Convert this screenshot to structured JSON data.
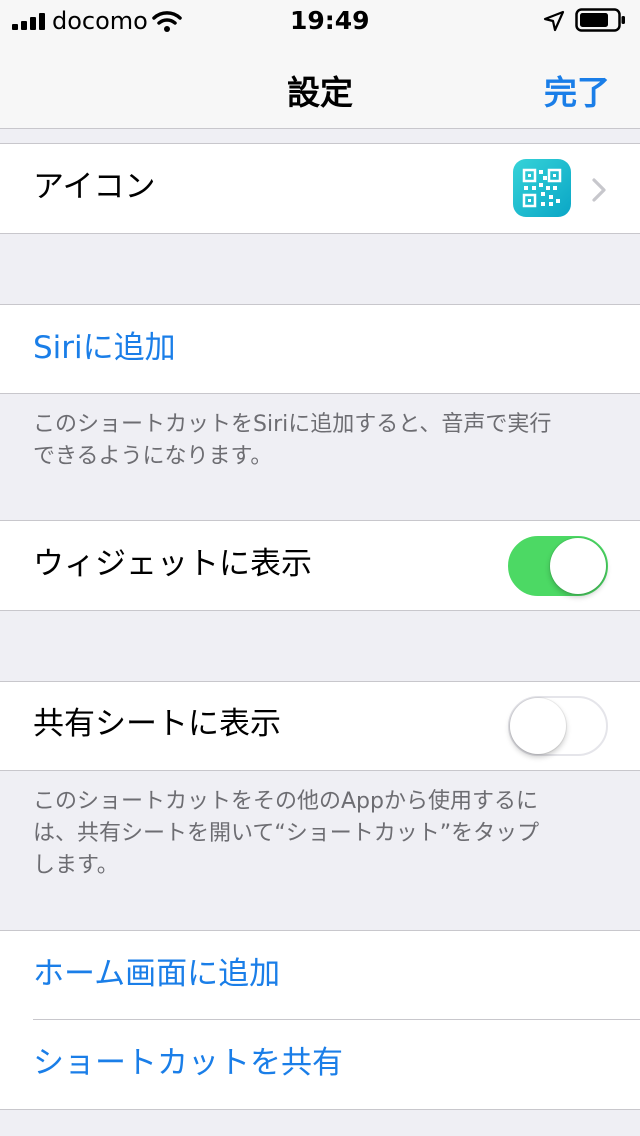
{
  "status_bar": {
    "carrier": "docomo",
    "time": "19:49",
    "battery_level": 0.8
  },
  "nav": {
    "title": "設定",
    "done_label": "完了"
  },
  "icon_row": {
    "label": "アイコン",
    "icon_color": "#16b6c8"
  },
  "siri": {
    "label": "Siriに追加",
    "footer_lines": [
      "このショートカットをSiriに追加すると、音声で実行",
      "できるようになります。"
    ]
  },
  "widget": {
    "label": "ウィジェットに表示",
    "enabled": true
  },
  "share_sheet": {
    "label": "共有シートに表示",
    "enabled": false,
    "footer_lines": [
      "このショートカットをその他のAppから使用するに",
      "は、共有シートを開いて“ショートカット”をタップ",
      "します。"
    ]
  },
  "actions": {
    "add_home": "ホーム画面に追加",
    "share": "ショートカットを共有"
  },
  "colors": {
    "accent": "#1a7ee8",
    "toggle_on": "#4cd964",
    "background": "#efeff4"
  }
}
